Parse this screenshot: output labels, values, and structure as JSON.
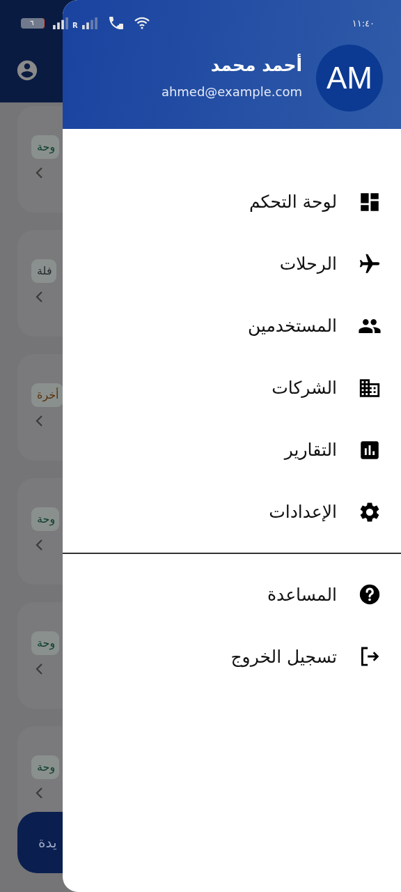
{
  "status_bar": {
    "battery": "٦",
    "roaming": "R",
    "time": "١١:٤٠"
  },
  "background_cards": [
    {
      "tag": "وحة",
      "color": "#0c3f2b"
    },
    {
      "tag": "فلة",
      "color": "#25292e"
    },
    {
      "tag": "أخرة",
      "color": "#5a3208"
    },
    {
      "tag": "وحة",
      "color": "#0c3f2b"
    },
    {
      "tag": "وحة",
      "color": "#0c3f2b"
    },
    {
      "tag": "وحة",
      "color": "#0c3f2b"
    }
  ],
  "fab": {
    "label": "يدة"
  },
  "drawer": {
    "user": {
      "initials": "AM",
      "name": "أحمد محمد",
      "email": "ahmed@example.com"
    },
    "items": [
      {
        "label": "لوحة التحكم",
        "kind": "dashboard"
      },
      {
        "label": "الرحلات",
        "kind": "flight"
      },
      {
        "label": "المستخدمين",
        "kind": "people"
      },
      {
        "label": "الشركات",
        "kind": "building"
      },
      {
        "label": "التقارير",
        "kind": "chart"
      },
      {
        "label": "الإعدادات",
        "kind": "settings"
      }
    ],
    "footer_items": [
      {
        "label": "المساعدة",
        "kind": "help"
      },
      {
        "label": "تسجيل الخروج",
        "kind": "logout"
      }
    ]
  }
}
